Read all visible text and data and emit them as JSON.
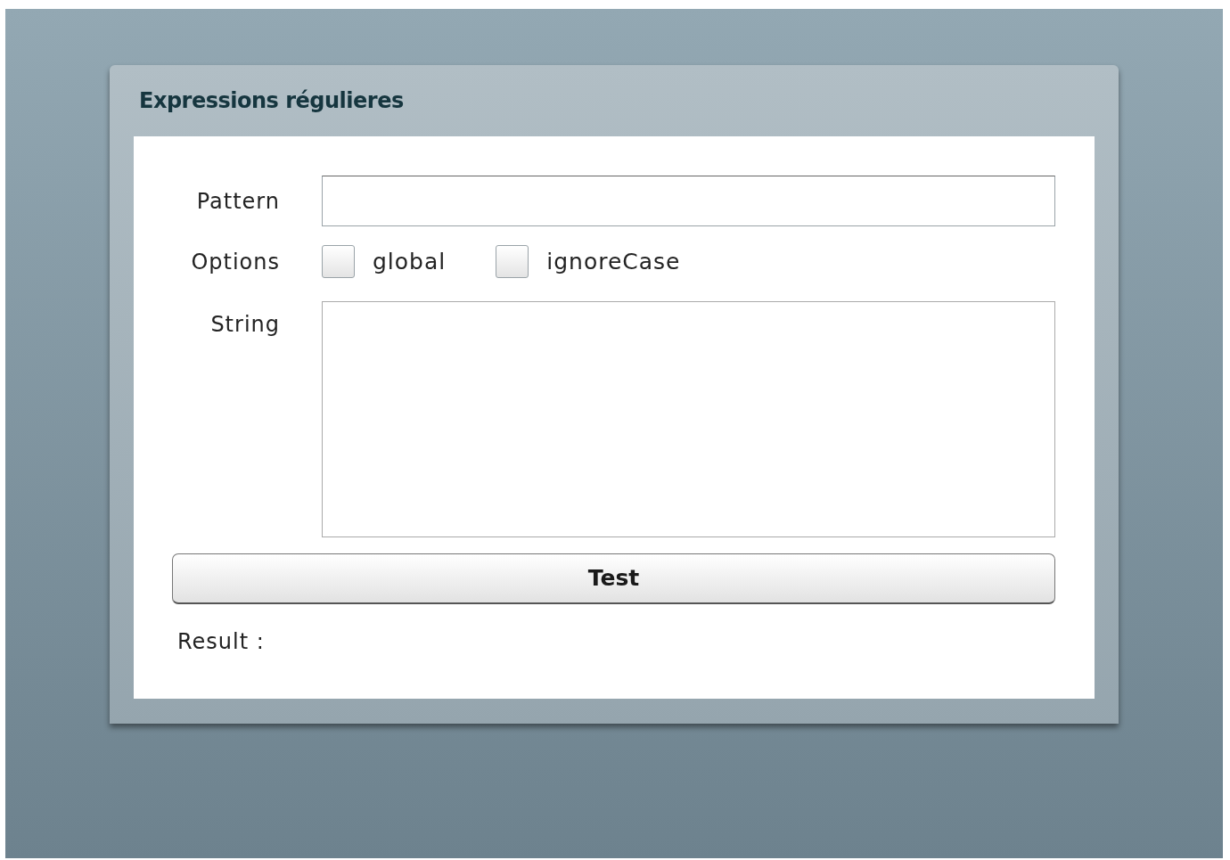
{
  "panel": {
    "title": "Expressions régulieres"
  },
  "form": {
    "pattern_label": "Pattern",
    "options_label": "Options",
    "string_label": "String",
    "options": [
      {
        "label": "global",
        "checked": false
      },
      {
        "label": "ignoreCase",
        "checked": false
      }
    ],
    "button": "Test",
    "result_label": "Result :"
  }
}
